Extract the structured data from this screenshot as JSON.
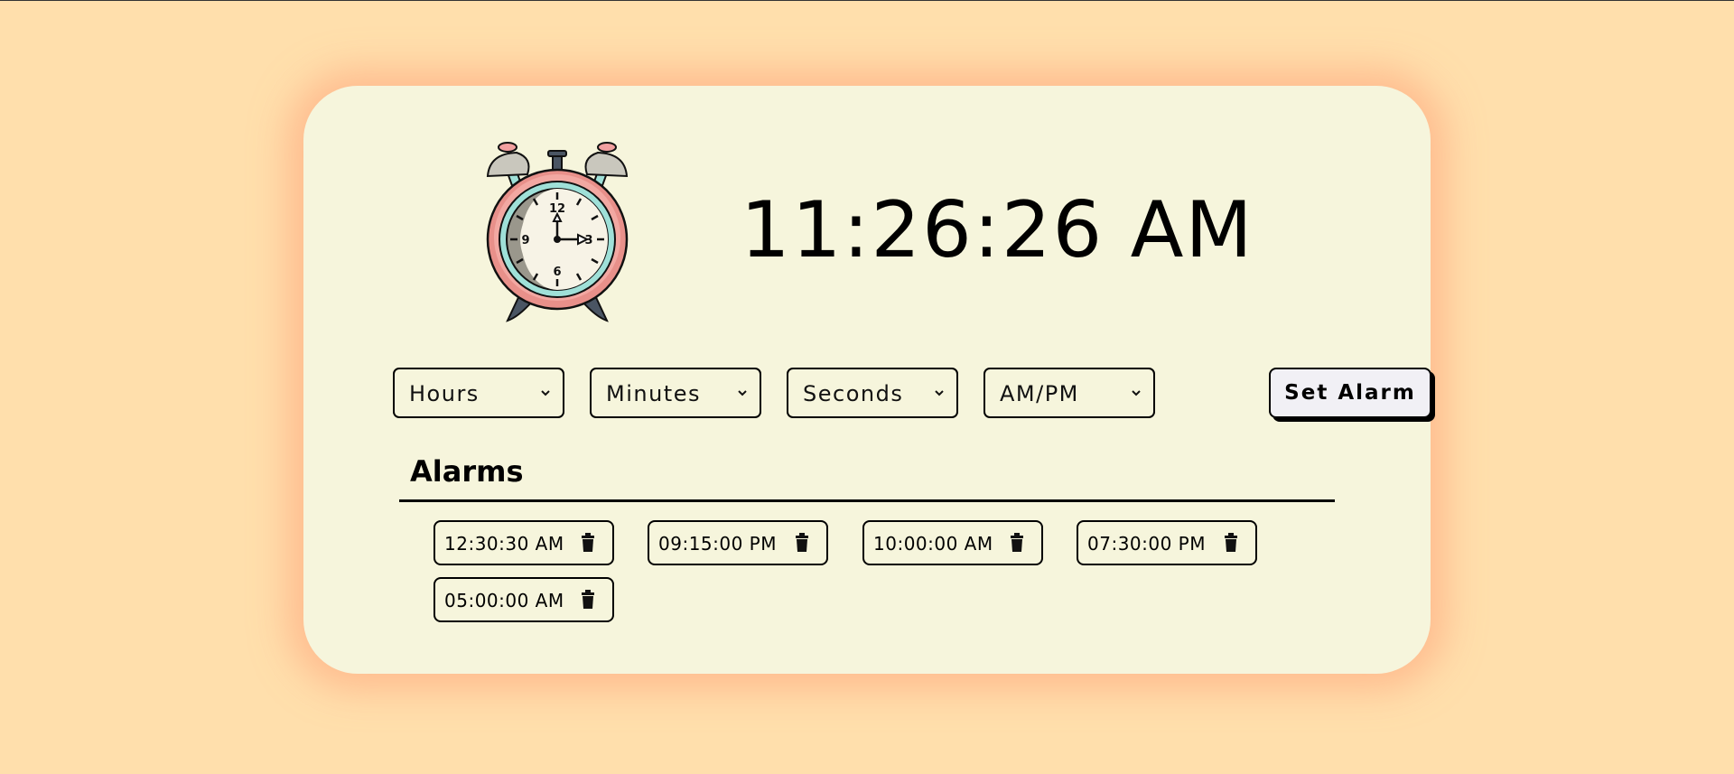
{
  "clock": {
    "current_time": "11:26:26 AM",
    "illustration_icon": "alarm-clock-icon"
  },
  "controls": {
    "hours_placeholder": "Hours",
    "minutes_placeholder": "Minutes",
    "seconds_placeholder": "Seconds",
    "ampm_placeholder": "AM/PM",
    "set_alarm_label": "Set Alarm"
  },
  "alarms": {
    "heading": "Alarms",
    "items": [
      {
        "time": "12:30:30 AM",
        "icon": "trash-icon"
      },
      {
        "time": "09:15:00 PM",
        "icon": "trash-icon"
      },
      {
        "time": "10:00:00 AM",
        "icon": "trash-icon"
      },
      {
        "time": "07:30:00 PM",
        "icon": "trash-icon"
      },
      {
        "time": "05:00:00 AM",
        "icon": "trash-icon"
      }
    ]
  },
  "colors": {
    "page_background": "#ffdfac",
    "card_background": "#f6f5dc",
    "card_glow": "#ffa078",
    "accent_dark": "#000000"
  }
}
